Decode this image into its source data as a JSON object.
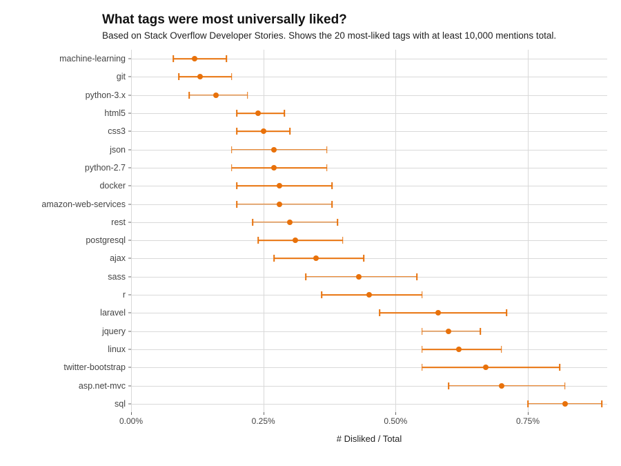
{
  "chart_data": {
    "type": "scatter",
    "title": "What tags were most universally liked?",
    "subtitle": "Based on Stack Overflow Developer Stories. Shows the 20 most-liked tags with at least 10,000 mentions total.",
    "xlabel": "# Disliked / Total",
    "ylabel": "",
    "xlim": [
      0.0,
      0.009
    ],
    "xticks": [
      0.0,
      0.0025,
      0.005,
      0.0075
    ],
    "xtick_labels": [
      "0.00%",
      "0.25%",
      "0.50%",
      "0.75%"
    ],
    "color": "#e8710a",
    "categories": [
      "machine-learning",
      "git",
      "python-3.x",
      "html5",
      "css3",
      "json",
      "python-2.7",
      "docker",
      "amazon-web-services",
      "rest",
      "postgresql",
      "ajax",
      "sass",
      "r",
      "laravel",
      "jquery",
      "linux",
      "twitter-bootstrap",
      "asp.net-mvc",
      "sql"
    ],
    "series": [
      {
        "name": "disliked_ratio",
        "points": [
          {
            "label": "machine-learning",
            "x": 0.0012,
            "low": 0.0008,
            "high": 0.0018
          },
          {
            "label": "git",
            "x": 0.0013,
            "low": 0.0009,
            "high": 0.0019
          },
          {
            "label": "python-3.x",
            "x": 0.0016,
            "low": 0.0011,
            "high": 0.0022
          },
          {
            "label": "html5",
            "x": 0.0024,
            "low": 0.002,
            "high": 0.0029
          },
          {
            "label": "css3",
            "x": 0.0025,
            "low": 0.002,
            "high": 0.003
          },
          {
            "label": "json",
            "x": 0.0027,
            "low": 0.0019,
            "high": 0.0037
          },
          {
            "label": "python-2.7",
            "x": 0.0027,
            "low": 0.0019,
            "high": 0.0037
          },
          {
            "label": "docker",
            "x": 0.0028,
            "low": 0.002,
            "high": 0.0038
          },
          {
            "label": "amazon-web-services",
            "x": 0.0028,
            "low": 0.002,
            "high": 0.0038
          },
          {
            "label": "rest",
            "x": 0.003,
            "low": 0.0023,
            "high": 0.0039
          },
          {
            "label": "postgresql",
            "x": 0.0031,
            "low": 0.0024,
            "high": 0.004
          },
          {
            "label": "ajax",
            "x": 0.0035,
            "low": 0.0027,
            "high": 0.0044
          },
          {
            "label": "sass",
            "x": 0.0043,
            "low": 0.0033,
            "high": 0.0054
          },
          {
            "label": "r",
            "x": 0.0045,
            "low": 0.0036,
            "high": 0.0055
          },
          {
            "label": "laravel",
            "x": 0.0058,
            "low": 0.0047,
            "high": 0.0071
          },
          {
            "label": "jquery",
            "x": 0.006,
            "low": 0.0055,
            "high": 0.0066
          },
          {
            "label": "linux",
            "x": 0.0062,
            "low": 0.0055,
            "high": 0.007
          },
          {
            "label": "twitter-bootstrap",
            "x": 0.0067,
            "low": 0.0055,
            "high": 0.0081
          },
          {
            "label": "asp.net-mvc",
            "x": 0.007,
            "low": 0.006,
            "high": 0.0082
          },
          {
            "label": "sql",
            "x": 0.0082,
            "low": 0.0075,
            "high": 0.0089
          }
        ]
      }
    ]
  }
}
